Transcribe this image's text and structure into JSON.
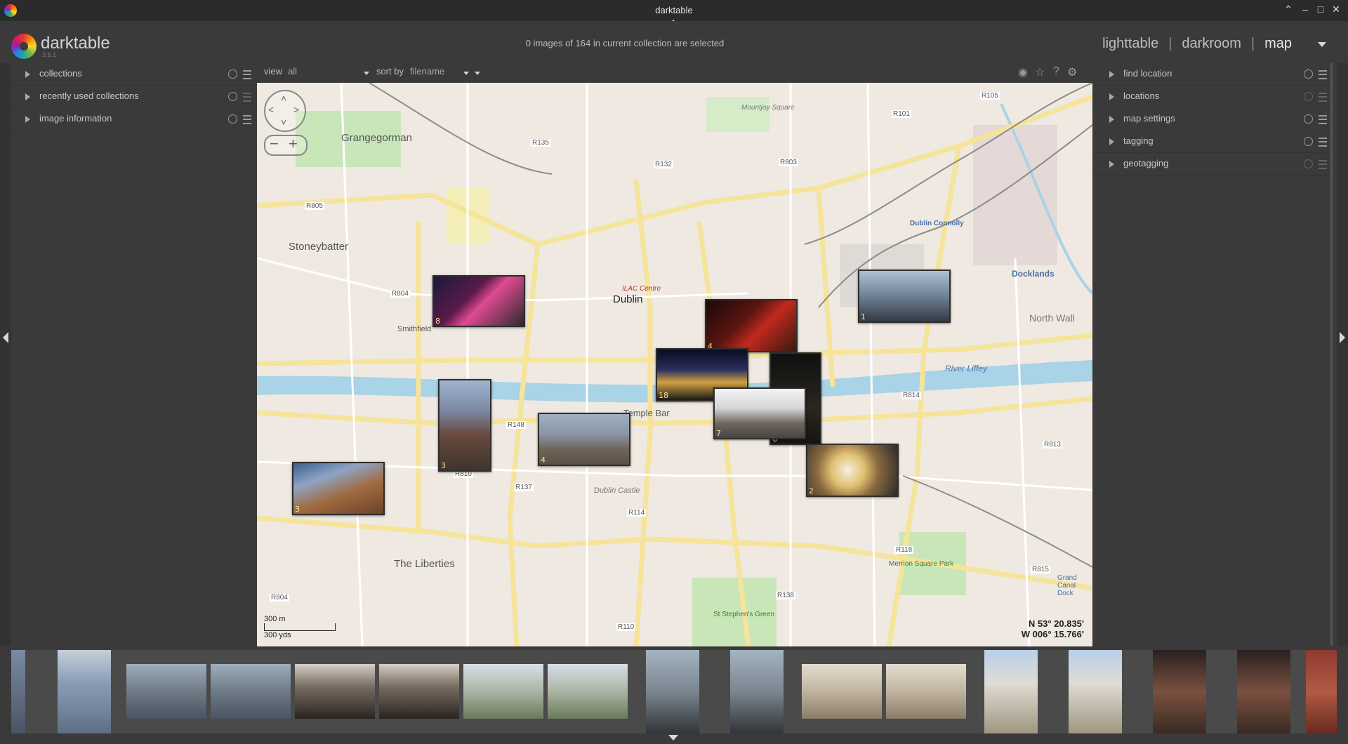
{
  "window": {
    "title": "darktable"
  },
  "header": {
    "brand": "darktable",
    "version": "3.6.1",
    "selection_info": "0 images of 164 in current collection are selected",
    "views": [
      "lighttable",
      "darkroom",
      "map"
    ],
    "separator": "|",
    "active_view": "map"
  },
  "left_panel": {
    "modules": [
      {
        "label": "collections"
      },
      {
        "label": "recently used collections"
      },
      {
        "label": "image information"
      }
    ]
  },
  "right_panel": {
    "modules": [
      {
        "label": "find location"
      },
      {
        "label": "locations"
      },
      {
        "label": "map settings"
      },
      {
        "label": "tagging"
      },
      {
        "label": "geotagging"
      }
    ]
  },
  "toolbar": {
    "view_label": "view",
    "view_value": "all",
    "sort_label": "sort by",
    "sort_value": "filename"
  },
  "map": {
    "labels": {
      "city": "Dublin",
      "grangegorman": "Grangegorman",
      "stoneybatter": "Stoneybatter",
      "liberties": "The Liberties",
      "smithfield": "Smithfield",
      "temple_bar": "Temple Bar",
      "docklands": "Docklands",
      "north_wall": "North Wall",
      "river_liffey": "River Liffey",
      "dublin_castle": "Dublin Castle",
      "ilac_centre": "ILAC Centre",
      "mountjoy_square": "Mountjoy Square",
      "merrion_square": "Merrion Square Park",
      "st_stephens": "St Stephen's Green",
      "grand_canal_dock": "Grand Canal Dock",
      "dublin_connolly": "Dublin Connolly",
      "r805": "R805",
      "r804": "R804",
      "r804b": "R804",
      "r132": "R132",
      "r135": "R135",
      "r803": "R803",
      "r101": "R101",
      "r105": "R105",
      "r148": "R148",
      "r810": "R810",
      "r137": "R137",
      "r114": "R114",
      "r110": "R110",
      "r138": "R138",
      "r118": "R118",
      "r815": "R815",
      "r813": "R813",
      "r814": "R814"
    },
    "scale": {
      "metric": "300 m",
      "imperial": "300 yds"
    },
    "coordinates": {
      "lat": "N 53° 20.835'",
      "lon": "W 006° 15.766'"
    },
    "image_groups": [
      {
        "count": "8"
      },
      {
        "count": "1"
      },
      {
        "count": "4"
      },
      {
        "count": "18"
      },
      {
        "count": "6"
      },
      {
        "count": "7"
      },
      {
        "count": "3"
      },
      {
        "count": "4"
      },
      {
        "count": "3"
      },
      {
        "count": "2"
      }
    ]
  },
  "filmstrip": {
    "thumbnails": [
      "street-wall",
      "blue-mural",
      "street-scene-1",
      "street-scene-2",
      "south-kensington-station-1",
      "south-kensington-station-2",
      "street-trees-1",
      "street-trees-2",
      "black-cab-1",
      "black-cab-2",
      "museum-arch-1",
      "museum-arch-2",
      "museum-facade-1",
      "museum-facade-2",
      "dark-interior-1",
      "dark-interior-2",
      "brick-building"
    ]
  }
}
